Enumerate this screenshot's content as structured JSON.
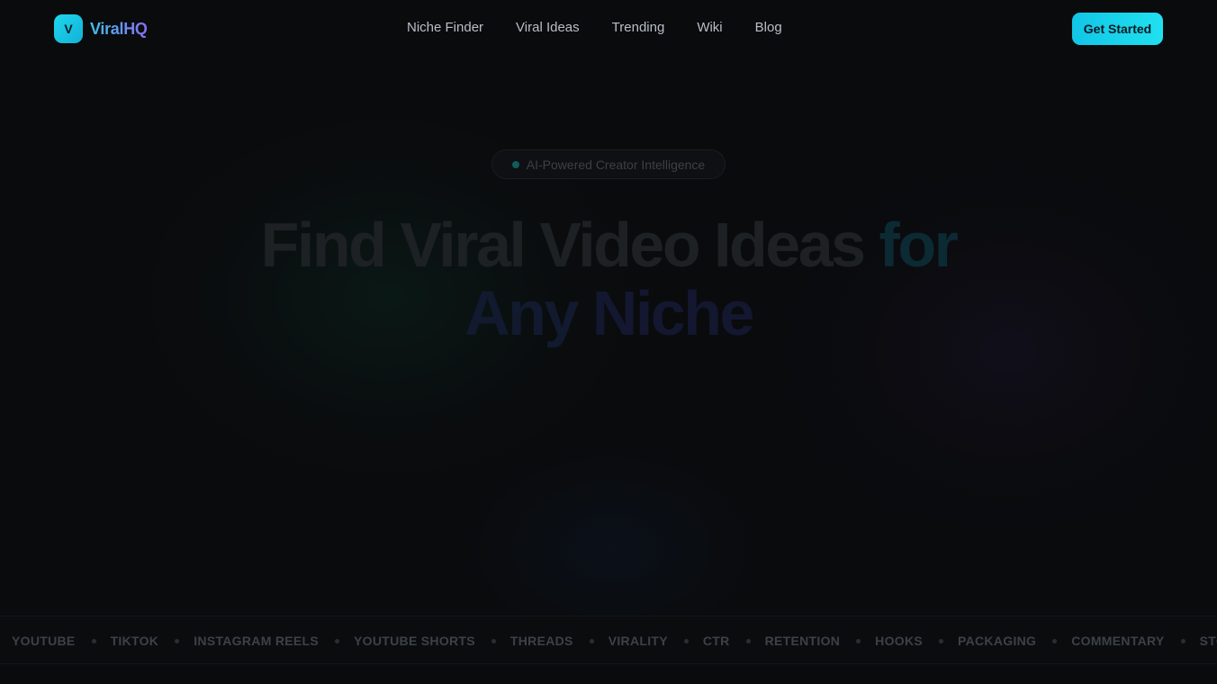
{
  "brand": {
    "logo_letter": "V",
    "name": "ViralHQ"
  },
  "nav": {
    "links": [
      {
        "label": "Niche Finder"
      },
      {
        "label": "Viral Ideas"
      },
      {
        "label": "Trending"
      },
      {
        "label": "Wiki"
      },
      {
        "label": "Blog"
      }
    ],
    "cta_label": "Get Started"
  },
  "hero": {
    "badge_text": "AI-Powered Creator Intelligence",
    "title_line1_main": "Find Viral Video Ideas",
    "title_line1_accent": "for",
    "title_line2_a": "Any",
    "title_line2_b": "Niche"
  },
  "ticker": {
    "items": [
      "YOUTUBE",
      "TIKTOK",
      "INSTAGRAM REELS",
      "YOUTUBE SHORTS",
      "THREADS",
      "VIRALITY",
      "CTR",
      "RETENTION",
      "HOOKS",
      "PACKAGING",
      "COMMENTARY",
      "STORYTELLING"
    ]
  },
  "colors": {
    "background": "#0a0b0d",
    "accent_cyan": "#1fd6ee",
    "accent_purple": "#8a6cf2"
  }
}
